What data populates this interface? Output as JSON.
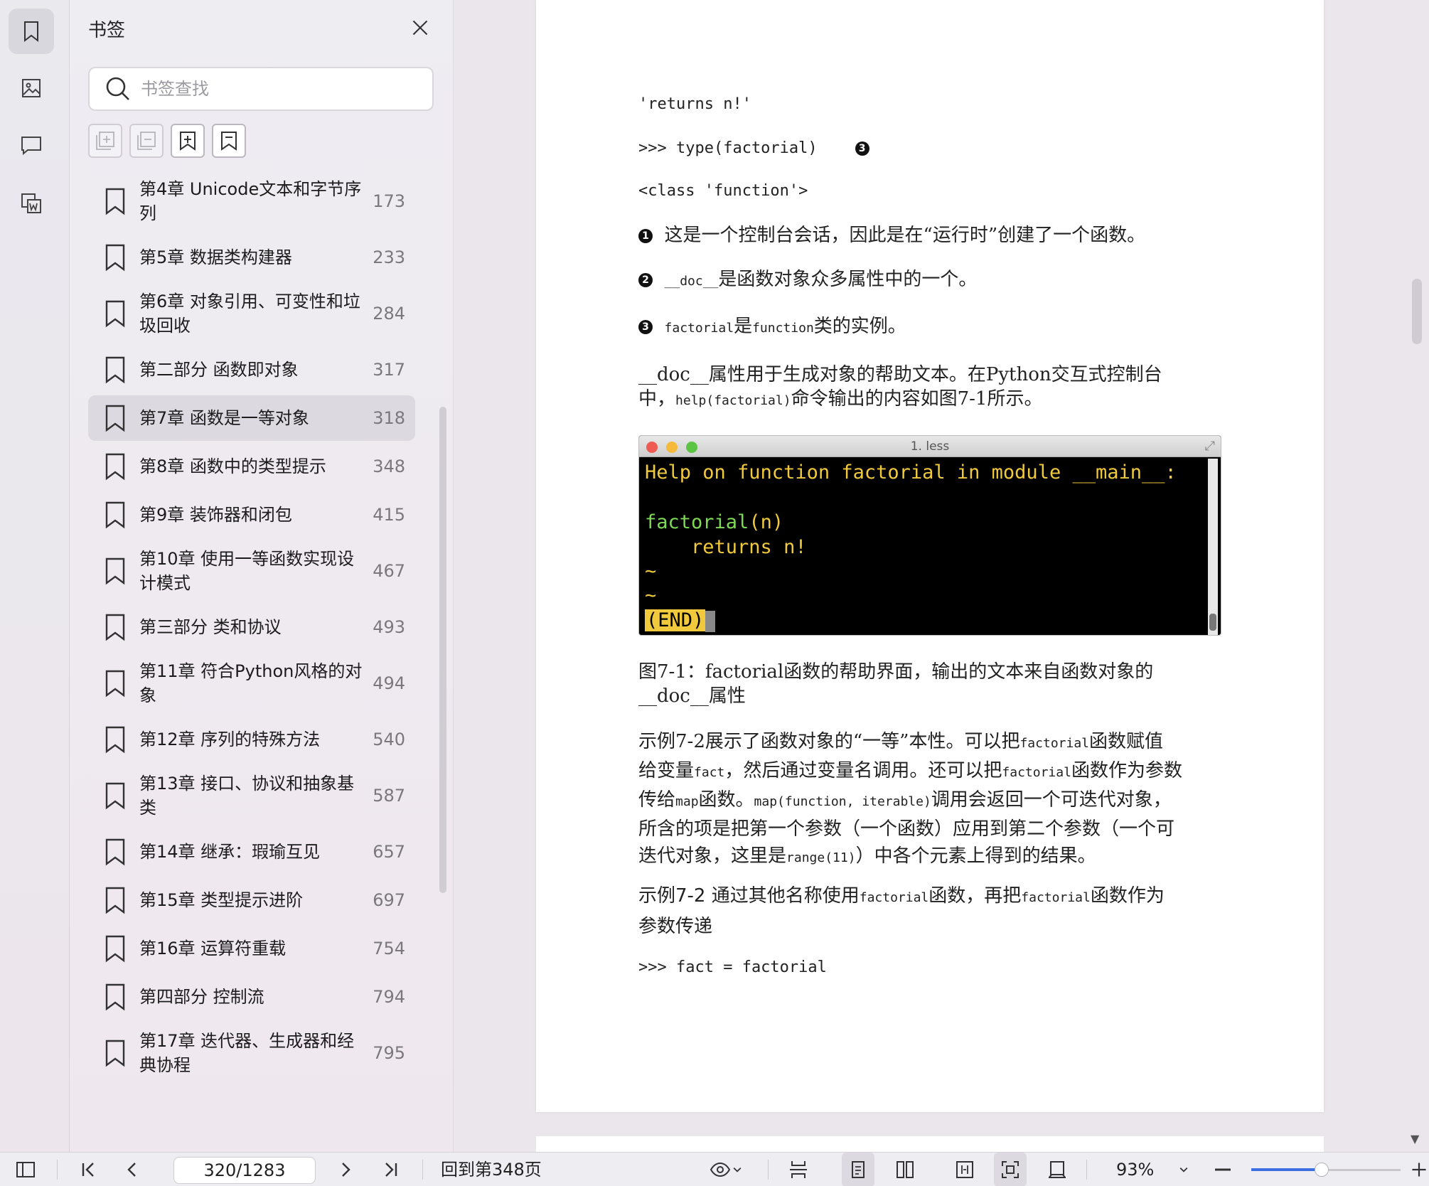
{
  "rail": {
    "items": [
      {
        "name": "bookmark",
        "active": true
      },
      {
        "name": "thumbnail",
        "active": false
      },
      {
        "name": "comment",
        "active": false
      },
      {
        "name": "convert",
        "active": false
      }
    ]
  },
  "panel": {
    "title": "书签",
    "search_placeholder": "书签查找",
    "bookmarks": [
      {
        "label": "第4章 Unicode文本和字节序列",
        "page": "173",
        "selected": false
      },
      {
        "label": "第5章 数据类构建器",
        "page": "233",
        "selected": false
      },
      {
        "label": "第6章 对象引用、可变性和垃圾回收",
        "page": "284",
        "selected": false
      },
      {
        "label": "第二部分 函数即对象",
        "page": "317",
        "selected": false
      },
      {
        "label": "第7章 函数是一等对象",
        "page": "318",
        "selected": true
      },
      {
        "label": "第8章 函数中的类型提示",
        "page": "348",
        "selected": false
      },
      {
        "label": "第9章 装饰器和闭包",
        "page": "415",
        "selected": false
      },
      {
        "label": "第10章 使用一等函数实现设计模式",
        "page": "467",
        "selected": false
      },
      {
        "label": "第三部分 类和协议",
        "page": "493",
        "selected": false
      },
      {
        "label": "第11章 符合Python风格的对象",
        "page": "494",
        "selected": false
      },
      {
        "label": "第12章 序列的特殊方法",
        "page": "540",
        "selected": false
      },
      {
        "label": "第13章 接口、协议和抽象基类",
        "page": "587",
        "selected": false
      },
      {
        "label": "第14章 继承：瑕瑜互见",
        "page": "657",
        "selected": false
      },
      {
        "label": "第15章 类型提示进阶",
        "page": "697",
        "selected": false
      },
      {
        "label": "第16章 运算符重载",
        "page": "754",
        "selected": false
      },
      {
        "label": "第四部分 控制流",
        "page": "794",
        "selected": false
      },
      {
        "label": "第17章 迭代器、生成器和经典协程",
        "page": "795",
        "selected": false
      }
    ]
  },
  "doc": {
    "line1": "'returns  n!'",
    "line2": ">>>  type(factorial)",
    "line3": "<class  'function'>",
    "callout1": "❶",
    "callout2": "❷",
    "callout3": "❸",
    "note1": "这是一个控制台会话，因此是在“运行时”创建了一个函数。",
    "note2_code": "__doc__",
    "note2_text": "是函数对象众多属性中的一个。",
    "note3_code1": "factorial",
    "note3_text1": "是",
    "note3_code2": "function",
    "note3_text2": "类的实例。",
    "para1_a": "__doc__属性用于生成对象的帮助文本。在Python交互式控制台",
    "para1_b": "中，",
    "para1_code": "help(factorial)",
    "para1_c": "命令输出的内容如图7-1所示。",
    "terminal": {
      "title": "1. less",
      "line1": "Help on function factorial in module __main__:",
      "line2_fn": "factorial",
      "line2_args": "(n)",
      "line3": "    returns n!",
      "tilde": "~",
      "end": "(END)"
    },
    "caption_a": "图7-1：factorial函数的帮助界面，输出的文本来自函数对象的",
    "caption_b": "__doc__属性",
    "p2_1a": "示例7-2展示了函数对象的“一等”本性。可以把",
    "p2_1code": "factorial",
    "p2_1b": "函数赋值",
    "p2_2a": "给变量",
    "p2_2code": "fact",
    "p2_2b": "，然后通过变量名调用。还可以把",
    "p2_2code2": "factorial",
    "p2_2c": "函数作为参数",
    "p2_3a": "传给",
    "p2_3code": "map",
    "p2_3b": "函数。",
    "p2_3code2": "map(function,  iterable)",
    "p2_3c": "调用会返回一个可迭代对象，",
    "p2_4": "所含的项是把第一个参数（一个函数）应用到第二个参数（一个可",
    "p2_5a": "迭代对象，这里是",
    "p2_5code": "range(11)",
    "p2_5b": "）中各个元素上得到的结果。",
    "ex_label": "示例7-2",
    "ex_a": "  通过其他名称使用",
    "ex_code1": "factorial",
    "ex_b": "函数，再把",
    "ex_code2": "factorial",
    "ex_c": "函数作为",
    "ex_d": "参数传递",
    "last_line": ">>>  fact  =  factorial"
  },
  "bottombar": {
    "page_value": "320/1283",
    "back_label": "回到第348页",
    "zoom": "93%",
    "zoom_fraction": 0.47
  }
}
